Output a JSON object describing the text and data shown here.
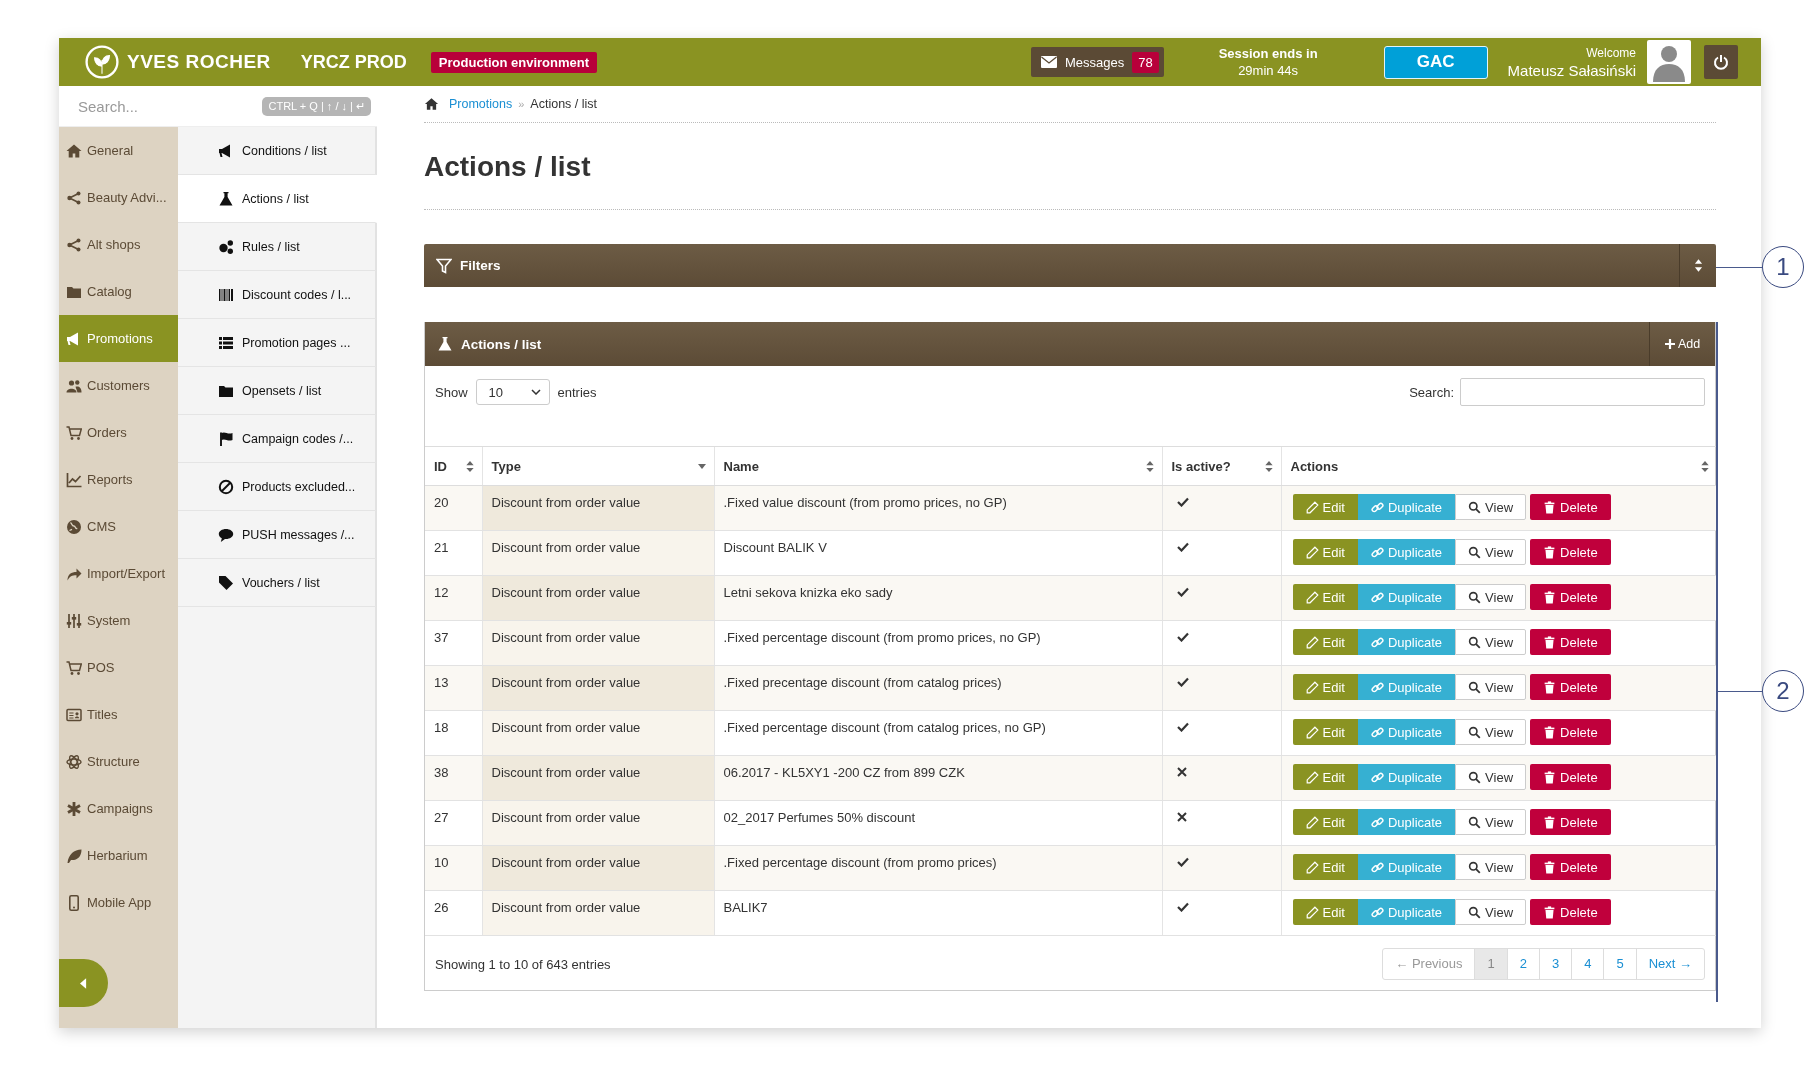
{
  "header": {
    "brand": "YVES ROCHER",
    "environment_name": "YRCZ PROD",
    "environment_badge": "Production environment",
    "messages": {
      "label": "Messages",
      "count": "78"
    },
    "session": {
      "label": "Session ends in",
      "remaining": "29min 44s"
    },
    "gac_button": "GAC",
    "welcome": "Welcome",
    "user_name": "Mateusz Sałasiński"
  },
  "sidebar": {
    "search": {
      "placeholder": "Search...",
      "shortcut_hint": "CTRL + Q | ↑ / ↓ | ↵"
    },
    "items": [
      {
        "label": "General",
        "selected": false
      },
      {
        "label": "Beauty Advi...",
        "selected": false
      },
      {
        "label": "Alt shops",
        "selected": false
      },
      {
        "label": "Catalog",
        "selected": false
      },
      {
        "label": "Promotions",
        "selected": true
      },
      {
        "label": "Customers",
        "selected": false
      },
      {
        "label": "Orders",
        "selected": false
      },
      {
        "label": "Reports",
        "selected": false
      },
      {
        "label": "CMS",
        "selected": false
      },
      {
        "label": "Import/Export",
        "selected": false
      },
      {
        "label": "System",
        "selected": false
      },
      {
        "label": "POS",
        "selected": false
      },
      {
        "label": "Titles",
        "selected": false
      },
      {
        "label": "Structure",
        "selected": false
      },
      {
        "label": "Campaigns",
        "selected": false
      },
      {
        "label": "Herbarium",
        "selected": false
      },
      {
        "label": "Mobile App",
        "selected": false
      }
    ],
    "subitems": [
      {
        "label": "Conditions / list",
        "selected": false
      },
      {
        "label": "Actions / list",
        "selected": true
      },
      {
        "label": "Rules / list",
        "selected": false
      },
      {
        "label": "Discount codes / l...",
        "selected": false
      },
      {
        "label": "Promotion pages ...",
        "selected": false
      },
      {
        "label": "Opensets / list",
        "selected": false
      },
      {
        "label": "Campaign codes /...",
        "selected": false
      },
      {
        "label": "Products excluded...",
        "selected": false
      },
      {
        "label": "PUSH messages /...",
        "selected": false
      },
      {
        "label": "Vouchers / list",
        "selected": false
      }
    ]
  },
  "breadcrumb": {
    "separator": "»",
    "items": [
      {
        "label": "Promotions",
        "link": true
      },
      {
        "label": "Actions / list",
        "link": false
      }
    ]
  },
  "page_title": "Actions / list",
  "filters_panel": {
    "title": "Filters"
  },
  "list_panel": {
    "title": "Actions / list",
    "add_button": "Add",
    "length_label_before": "Show",
    "length_value": "10",
    "length_label_after": "entries",
    "search_label": "Search:",
    "table": {
      "columns": [
        {
          "label": "ID",
          "sorted": false
        },
        {
          "label": "Type",
          "sorted": true
        },
        {
          "label": "Name",
          "sorted": false
        },
        {
          "label": "Is active?",
          "sorted": false
        },
        {
          "label": "Actions",
          "sorted": false
        }
      ],
      "rows": [
        {
          "id": "20",
          "type": "Discount from order value",
          "name": ".Fixed value discount (from promo prices, no GP)",
          "active": true,
          "actions": [
            {
              "kind": "edit",
              "label": "Edit"
            },
            {
              "kind": "duplicate",
              "label": "Duplicate"
            },
            {
              "kind": "view",
              "label": "View"
            },
            {
              "kind": "delete",
              "label": "Delete"
            }
          ]
        },
        {
          "id": "21",
          "type": "Discount from order value",
          "name": "Discount BALIK V",
          "active": true,
          "actions": [
            {
              "kind": "edit",
              "label": "Edit"
            },
            {
              "kind": "duplicate",
              "label": "Duplicate"
            },
            {
              "kind": "view",
              "label": "View"
            },
            {
              "kind": "delete",
              "label": "Delete"
            }
          ]
        },
        {
          "id": "12",
          "type": "Discount from order value",
          "name": "Letni sekova knizka eko sady",
          "active": true,
          "actions": [
            {
              "kind": "edit",
              "label": "Edit"
            },
            {
              "kind": "duplicate",
              "label": "Duplicate"
            },
            {
              "kind": "view",
              "label": "View"
            },
            {
              "kind": "delete",
              "label": "Delete"
            }
          ]
        },
        {
          "id": "37",
          "type": "Discount from order value",
          "name": ".Fixed percentage discount (from promo prices, no GP)",
          "active": true,
          "actions": [
            {
              "kind": "edit",
              "label": "Edit"
            },
            {
              "kind": "duplicate",
              "label": "Duplicate"
            },
            {
              "kind": "view",
              "label": "View"
            },
            {
              "kind": "delete",
              "label": "Delete"
            }
          ]
        },
        {
          "id": "13",
          "type": "Discount from order value",
          "name": ".Fixed precentage discount (from catalog prices)",
          "active": true,
          "actions": [
            {
              "kind": "edit",
              "label": "Edit"
            },
            {
              "kind": "duplicate",
              "label": "Duplicate"
            },
            {
              "kind": "view",
              "label": "View"
            },
            {
              "kind": "delete",
              "label": "Delete"
            }
          ]
        },
        {
          "id": "18",
          "type": "Discount from order value",
          "name": ".Fixed percentage discount (from catalog prices, no GP)",
          "active": true,
          "actions": [
            {
              "kind": "edit",
              "label": "Edit"
            },
            {
              "kind": "duplicate",
              "label": "Duplicate"
            },
            {
              "kind": "view",
              "label": "View"
            },
            {
              "kind": "delete",
              "label": "Delete"
            }
          ]
        },
        {
          "id": "38",
          "type": "Discount from order value",
          "name": "06.2017 - KL5XY1 -200 CZ from 899 CZK",
          "active": false,
          "actions": [
            {
              "kind": "edit",
              "label": "Edit"
            },
            {
              "kind": "duplicate",
              "label": "Duplicate"
            },
            {
              "kind": "view",
              "label": "View"
            },
            {
              "kind": "delete",
              "label": "Delete"
            }
          ]
        },
        {
          "id": "27",
          "type": "Discount from order value",
          "name": "02_2017 Perfumes 50% discount",
          "active": false,
          "actions": [
            {
              "kind": "edit",
              "label": "Edit"
            },
            {
              "kind": "duplicate",
              "label": "Duplicate"
            },
            {
              "kind": "view",
              "label": "View"
            },
            {
              "kind": "delete",
              "label": "Delete"
            }
          ]
        },
        {
          "id": "10",
          "type": "Discount from order value",
          "name": ".Fixed percentage discount (from promo prices)",
          "active": true,
          "actions": [
            {
              "kind": "edit",
              "label": "Edit"
            },
            {
              "kind": "duplicate",
              "label": "Duplicate"
            },
            {
              "kind": "view",
              "label": "View"
            },
            {
              "kind": "delete",
              "label": "Delete"
            }
          ]
        },
        {
          "id": "26",
          "type": "Discount from order value",
          "name": "BALIK7",
          "active": true,
          "actions": [
            {
              "kind": "edit",
              "label": "Edit"
            },
            {
              "kind": "duplicate",
              "label": "Duplicate"
            },
            {
              "kind": "view",
              "label": "View"
            },
            {
              "kind": "delete",
              "label": "Delete"
            }
          ]
        }
      ]
    },
    "info": "Showing 1 to 10 of 643 entries",
    "pagination": [
      {
        "label": "← Previous",
        "selected": false,
        "disabled": true
      },
      {
        "label": "1",
        "selected": true,
        "disabled": false
      },
      {
        "label": "2",
        "selected": false,
        "disabled": false
      },
      {
        "label": "3",
        "selected": false,
        "disabled": false
      },
      {
        "label": "4",
        "selected": false,
        "disabled": false
      },
      {
        "label": "5",
        "selected": false,
        "disabled": false
      },
      {
        "label": "Next →",
        "selected": false,
        "disabled": false
      }
    ]
  },
  "callouts": [
    {
      "label": "1",
      "kind": "line"
    },
    {
      "label": "2",
      "kind": "bracket"
    }
  ]
}
